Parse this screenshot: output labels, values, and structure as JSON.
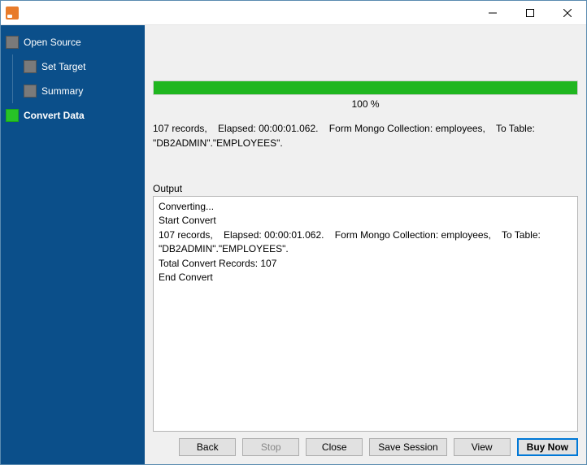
{
  "titlebar": {
    "title": ""
  },
  "sidebar": {
    "items": [
      {
        "label": "Open Source",
        "active": false
      },
      {
        "label": "Set Target",
        "active": false
      },
      {
        "label": "Summary",
        "active": false
      },
      {
        "label": "Convert Data",
        "active": true
      }
    ]
  },
  "progress": {
    "percent_label": "100 %",
    "status": "107 records,    Elapsed: 00:00:01.062.    Form Mongo Collection: employees,    To Table: \"DB2ADMIN\".\"EMPLOYEES\"."
  },
  "output": {
    "label": "Output",
    "text": "Converting...\nStart Convert\n107 records,    Elapsed: 00:00:01.062.    Form Mongo Collection: employees,    To Table: \"DB2ADMIN\".\"EMPLOYEES\".\nTotal Convert Records: 107\nEnd Convert"
  },
  "buttons": {
    "back": "Back",
    "stop": "Stop",
    "close": "Close",
    "save_session": "Save Session",
    "view": "View",
    "buy_now": "Buy Now"
  }
}
